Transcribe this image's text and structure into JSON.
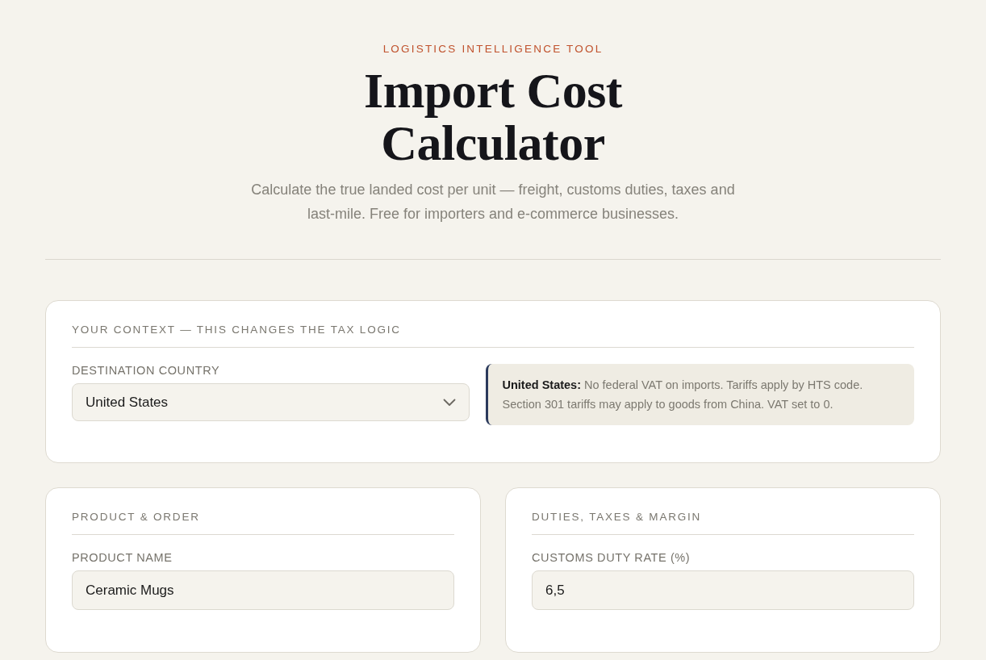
{
  "header": {
    "eyebrow": "LOGISTICS INTELLIGENCE TOOL",
    "title": "Import Cost Calculator",
    "subtitle": "Calculate the true landed cost per unit — freight, customs duties, taxes and last-mile. Free for importers and e-commerce businesses."
  },
  "context": {
    "heading": "YOUR CONTEXT — THIS CHANGES THE TAX LOGIC",
    "label": "DESTINATION COUNTRY",
    "value": "United States",
    "note": "**United States:** No federal VAT on imports. Tariffs apply by HTS code. Section 301 tariffs may apply to goods from China. VAT set to 0."
  },
  "panels": [
    {
      "heading": "PRODUCT & ORDER",
      "fields": [
        {
          "label": "PRODUCT NAME",
          "value": "Ceramic Mugs"
        }
      ]
    },
    {
      "heading": "DUTIES, TAXES & MARGIN",
      "fields": [
        {
          "label": "CUSTOMS DUTY RATE (%)",
          "value": "6,5"
        }
      ]
    }
  ]
}
